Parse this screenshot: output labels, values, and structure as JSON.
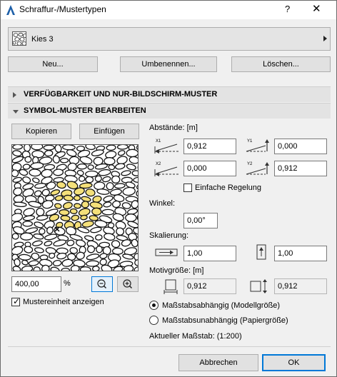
{
  "window": {
    "title": "Schraffur-/Mustertypen",
    "help": "?",
    "close": "✕"
  },
  "selector": {
    "name": "Kies 3"
  },
  "top_buttons": {
    "new": "Neu...",
    "rename": "Umbenennen...",
    "delete": "Löschen..."
  },
  "sections": {
    "availability": "VERFÜGBARKEIT UND NUR-BILDSCHIRM-MUSTER",
    "edit": "SYMBOL-MUSTER BEARBEITEN"
  },
  "edit_buttons": {
    "copy": "Kopieren",
    "paste": "Einfügen"
  },
  "spacing": {
    "label": "Abstände: [m]",
    "x1": {
      "icon_label": "X1",
      "value": "0,912"
    },
    "y1": {
      "icon_label": "Y1",
      "value": "0,000"
    },
    "x2": {
      "icon_label": "X2",
      "value": "0,000"
    },
    "y2": {
      "icon_label": "Y2",
      "value": "0,912"
    },
    "simple_label": "Einfache Regelung",
    "simple_checked": false
  },
  "angle": {
    "label": "Winkel:",
    "value": "0,00°"
  },
  "scaling": {
    "label": "Skalierung:",
    "x_value": "1,00",
    "y_value": "1,00"
  },
  "motif": {
    "label": "Motivgröße: [m]",
    "x_value": "0,912",
    "y_value": "0,912"
  },
  "scale_mode": {
    "model": "Maßstabsabhängig (Modellgröße)",
    "paper": "Maßstabsunabhängig (Papiergröße)",
    "selected": "model"
  },
  "current_scale": "Aktueller Maßstab: (1:200)",
  "preview": {
    "zoom_value": "400,00",
    "zoom_unit": "%",
    "show_unit_label": "Mustereinheit anzeigen",
    "show_unit_checked": true,
    "highlight_color": "#f4e07a"
  },
  "footer": {
    "cancel": "Abbrechen",
    "ok": "OK"
  }
}
